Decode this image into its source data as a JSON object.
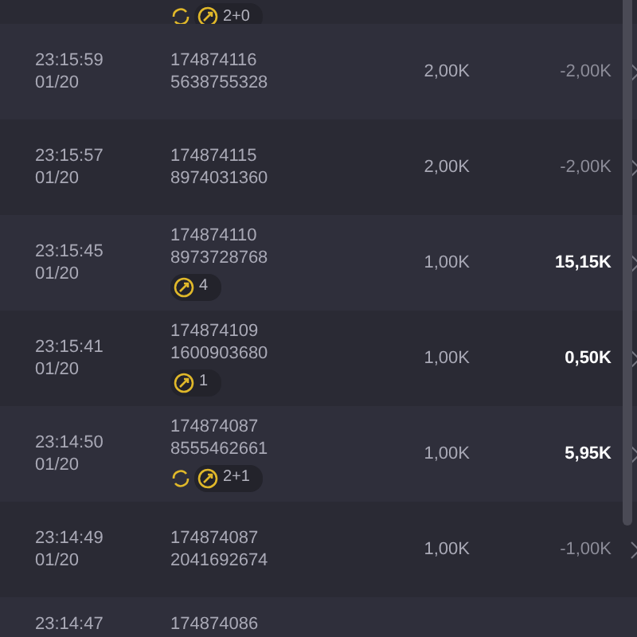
{
  "rows": [
    {
      "time": "",
      "date": "",
      "id_line1": "",
      "id_line2": "",
      "amount": "",
      "result": "",
      "badges": [
        {
          "kind": "refresh"
        },
        {
          "kind": "bonus",
          "count": "2+0"
        }
      ]
    },
    {
      "time": "23:15:59",
      "date": "01/20",
      "id_line1": "174874116",
      "id_line2": "5638755328",
      "amount": "2,00K",
      "result": "-2,00K",
      "positive": false,
      "badges": []
    },
    {
      "time": "23:15:57",
      "date": "01/20",
      "id_line1": "174874115",
      "id_line2": "8974031360",
      "amount": "2,00K",
      "result": "-2,00K",
      "positive": false,
      "badges": []
    },
    {
      "time": "23:15:45",
      "date": "01/20",
      "id_line1": "174874110",
      "id_line2": "8973728768",
      "amount": "1,00K",
      "result": "15,15K",
      "positive": true,
      "badges": [
        {
          "kind": "bonus",
          "count": "4"
        }
      ]
    },
    {
      "time": "23:15:41",
      "date": "01/20",
      "id_line1": "174874109",
      "id_line2": "1600903680",
      "amount": "1,00K",
      "result": "0,50K",
      "positive": true,
      "badges": [
        {
          "kind": "bonus",
          "count": "1"
        }
      ]
    },
    {
      "time": "23:14:50",
      "date": "01/20",
      "id_line1": "174874087",
      "id_line2": "8555462661",
      "amount": "1,00K",
      "result": "5,95K",
      "positive": true,
      "badges": [
        {
          "kind": "refresh"
        },
        {
          "kind": "bonus",
          "count": "2+1"
        }
      ]
    },
    {
      "time": "23:14:49",
      "date": "01/20",
      "id_line1": "174874087",
      "id_line2": "2041692674",
      "amount": "1,00K",
      "result": "-1,00K",
      "positive": false,
      "badges": []
    },
    {
      "time": "23:14:47",
      "date": "",
      "id_line1": "174874086",
      "id_line2": "",
      "amount": "",
      "result": "",
      "badges": []
    }
  ]
}
